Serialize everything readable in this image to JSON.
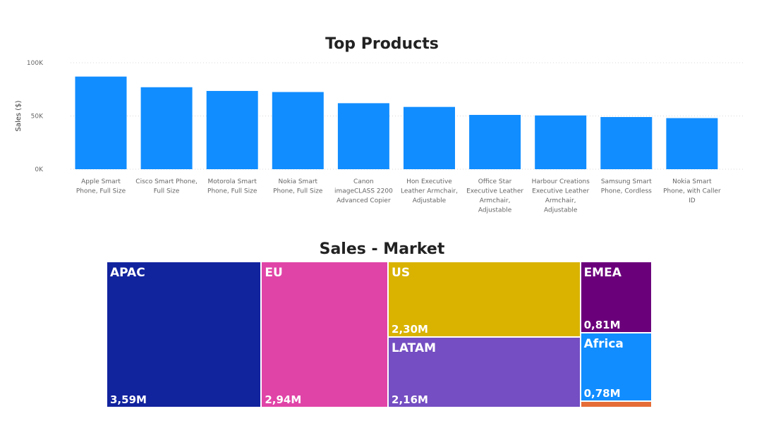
{
  "colors": {
    "bar": "#118DFF",
    "grid": "#d8d8d8",
    "axis_text": "#666666",
    "title_text": "#222222"
  },
  "chart_data": [
    {
      "type": "bar",
      "title": "Top Products",
      "xlabel": "",
      "ylabel": "Sales ($)",
      "ylim": [
        0,
        100000
      ],
      "yticks": [
        0,
        50000,
        100000
      ],
      "ytick_labels": [
        "0K",
        "50K",
        "100K"
      ],
      "grid": true,
      "categories": [
        [
          "Apple Smart",
          "Phone, Full Size"
        ],
        [
          "Cisco Smart Phone,",
          "Full Size"
        ],
        [
          "Motorola Smart",
          "Phone, Full Size"
        ],
        [
          "Nokia Smart",
          "Phone, Full Size"
        ],
        [
          "Canon",
          "imageCLASS 2200",
          "Advanced Copier"
        ],
        [
          "Hon Executive",
          "Leather Armchair,",
          "Adjustable"
        ],
        [
          "Office Star",
          "Executive Leather",
          "Armchair,",
          "Adjustable"
        ],
        [
          "Harbour Creations",
          "Executive Leather",
          "Armchair,",
          "Adjustable"
        ],
        [
          "Samsung Smart",
          "Phone, Cordless"
        ],
        [
          "Nokia Smart",
          "Phone, with Caller",
          "ID"
        ]
      ],
      "values": [
        87000,
        77000,
        73500,
        72500,
        62000,
        58500,
        51000,
        50500,
        49000,
        48000
      ]
    },
    {
      "type": "treemap",
      "title": "Sales - Market",
      "items": [
        {
          "name": "APAC",
          "label": "3,59M",
          "value": 3.59,
          "color": "#12239E"
        },
        {
          "name": "EU",
          "label": "2,94M",
          "value": 2.94,
          "color": "#E044A7"
        },
        {
          "name": "US",
          "label": "2,30M",
          "value": 2.3,
          "color": "#D9B300"
        },
        {
          "name": "LATAM",
          "label": "2,16M",
          "value": 2.16,
          "color": "#744EC2"
        },
        {
          "name": "EMEA",
          "label": "0,81M",
          "value": 0.81,
          "color": "#6B007B"
        },
        {
          "name": "Africa",
          "label": "0,78M",
          "value": 0.78,
          "color": "#118DFF"
        },
        {
          "name": "",
          "label": "",
          "value": 0.07,
          "color": "#E66C37"
        }
      ]
    }
  ]
}
